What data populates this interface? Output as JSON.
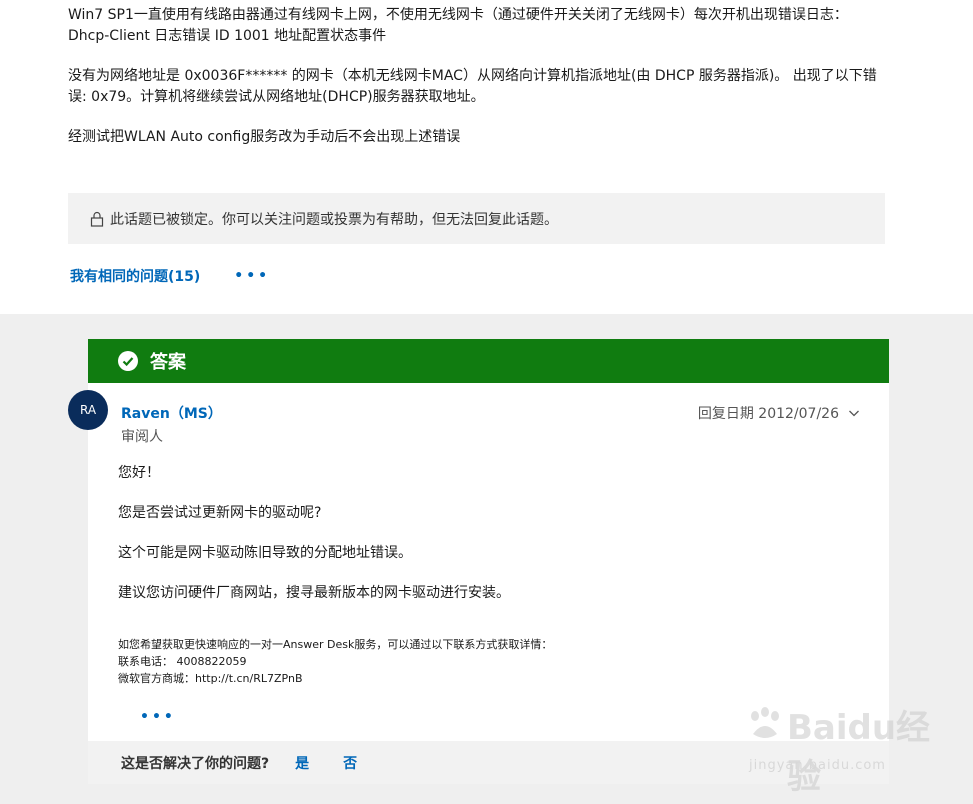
{
  "question": {
    "paragraphs": [
      "Win7 SP1一直使用有线路由器通过有线网卡上网，不使用无线网卡（通过硬件开关关闭了无线网卡）每次开机出现错误日志： Dhcp-Client 日志错误 ID 1001 地址配置状态事件",
      "没有为网络地址是 0x0036F****** 的网卡（本机无线网卡MAC）从网络向计算机指派地址(由 DHCP 服务器指派)。 出现了以下错误: 0x79。计算机将继续尝试从网络地址(DHCP)服务器获取地址。",
      "经测试把WLAN Auto config服务改为手动后不会出现上述错误"
    ]
  },
  "lock_notice": "此话题已被锁定。你可以关注问题或投票为有帮助，但无法回复此话题。",
  "same_question": {
    "label": "我有相同的问题(15)",
    "more": "•••"
  },
  "answer": {
    "header": "答案",
    "avatar_initials": "RA",
    "author": "Raven（MS）",
    "role": "审阅人",
    "reply_date": "回复日期 2012/07/26",
    "body": [
      "您好！",
      "您是否尝试过更新网卡的驱动呢?",
      "这个可能是网卡驱动陈旧导致的分配地址错误。",
      "建议您访问硬件厂商网站，搜寻最新版本的网卡驱动进行安装。"
    ],
    "contact": [
      "如您希望获取更快速响应的一对一Answer Desk服务，可以通过以下联系方式获取详情：",
      "联系电话： 4008822059",
      "微软官方商城：http://t.cn/RL7ZPnB"
    ],
    "more": "•••"
  },
  "helpful": {
    "question": "这是否解决了你的问题?",
    "yes": "是",
    "no": "否"
  },
  "watermark": {
    "brand": "Baidu经验",
    "url": "jingyan.baidu.com"
  },
  "colors": {
    "accent": "#0067b8",
    "answer_green": "#107c10",
    "avatar_bg": "#0a2c5b"
  }
}
